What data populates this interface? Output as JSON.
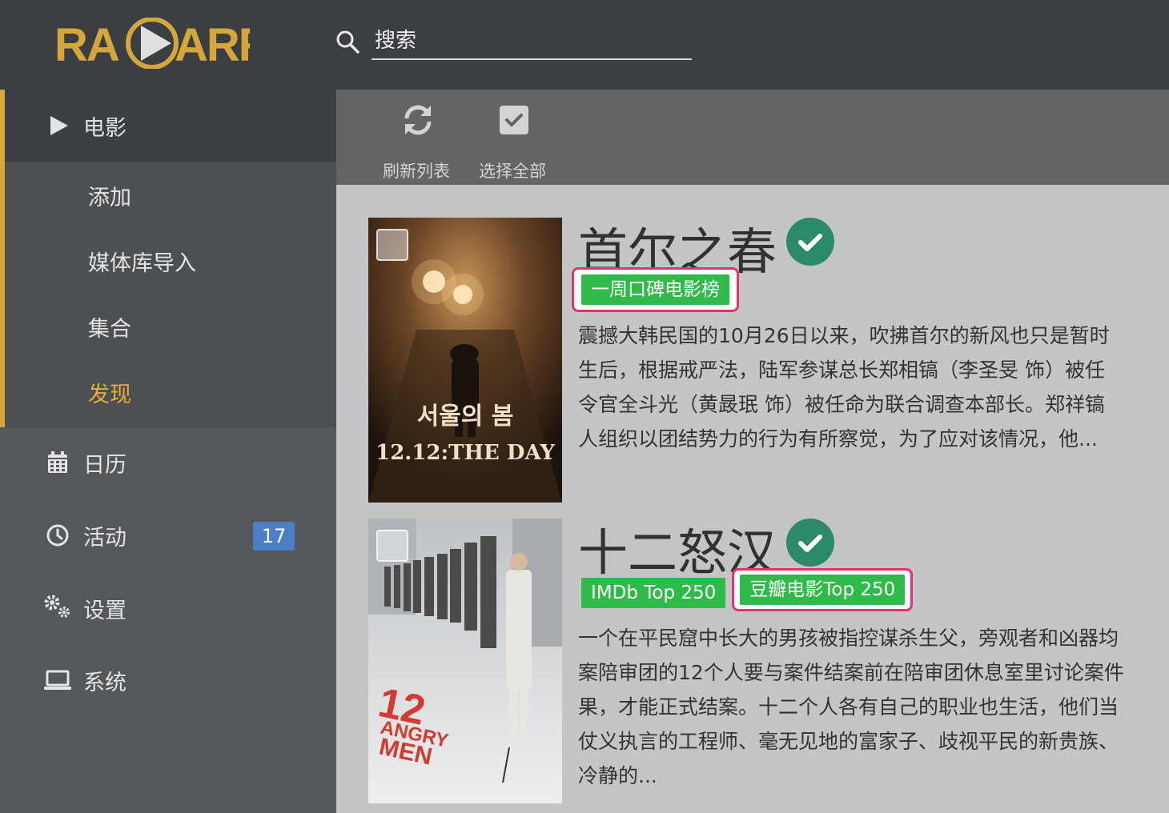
{
  "app": {
    "logo_text": "RADARR",
    "brand_color": "#d4a73a"
  },
  "search": {
    "placeholder": "搜索",
    "value": ""
  },
  "sidebar": {
    "movies": "电影",
    "sub": [
      "添加",
      "媒体库导入",
      "集合",
      "发现"
    ],
    "calendar": "日历",
    "activity": "活动",
    "activity_badge": "17",
    "settings": "设置",
    "system": "系统"
  },
  "toolbar": {
    "refresh": "刷新列表",
    "select_all": "选择全部"
  },
  "movies": [
    {
      "title": "首尔之春",
      "poster_text_kr": "서울의 봄",
      "poster_text_en": "12.12:THE DAY",
      "tags": [
        "一周口碑电影榜"
      ],
      "desc_lines": [
        "震撼大韩民国的10月26日以来，吹拂首尔的新风也只是暂时",
        "生后，根据戒严法，陆军参谋总长郑相镐（李圣旻 饰）被任",
        "令官全斗光（黄晸珉 饰）被任命为联合调查本部长。郑祥镐",
        "人组织以团结势力的行为有所察觉，为了应对该情况，他..."
      ]
    },
    {
      "title": "十二怒汉",
      "poster_text_en_1": "12",
      "poster_text_en_2": "ANGRY",
      "poster_text_en_3": "MEN",
      "tags": [
        "IMDb Top 250",
        "豆瓣电影Top 250"
      ],
      "desc_lines": [
        "一个在平民窟中长大的男孩被指控谋杀生父，旁观者和凶器均",
        "案陪审团的12个人要与案件结案前在陪审团休息室里讨论案件",
        "果，才能正式结案。十二个人各有自己的职业也生活，他们当",
        "仗义执言的工程师、毫无见地的富家子、歧视平民的新贵族、",
        "冷静的..."
      ]
    }
  ]
}
